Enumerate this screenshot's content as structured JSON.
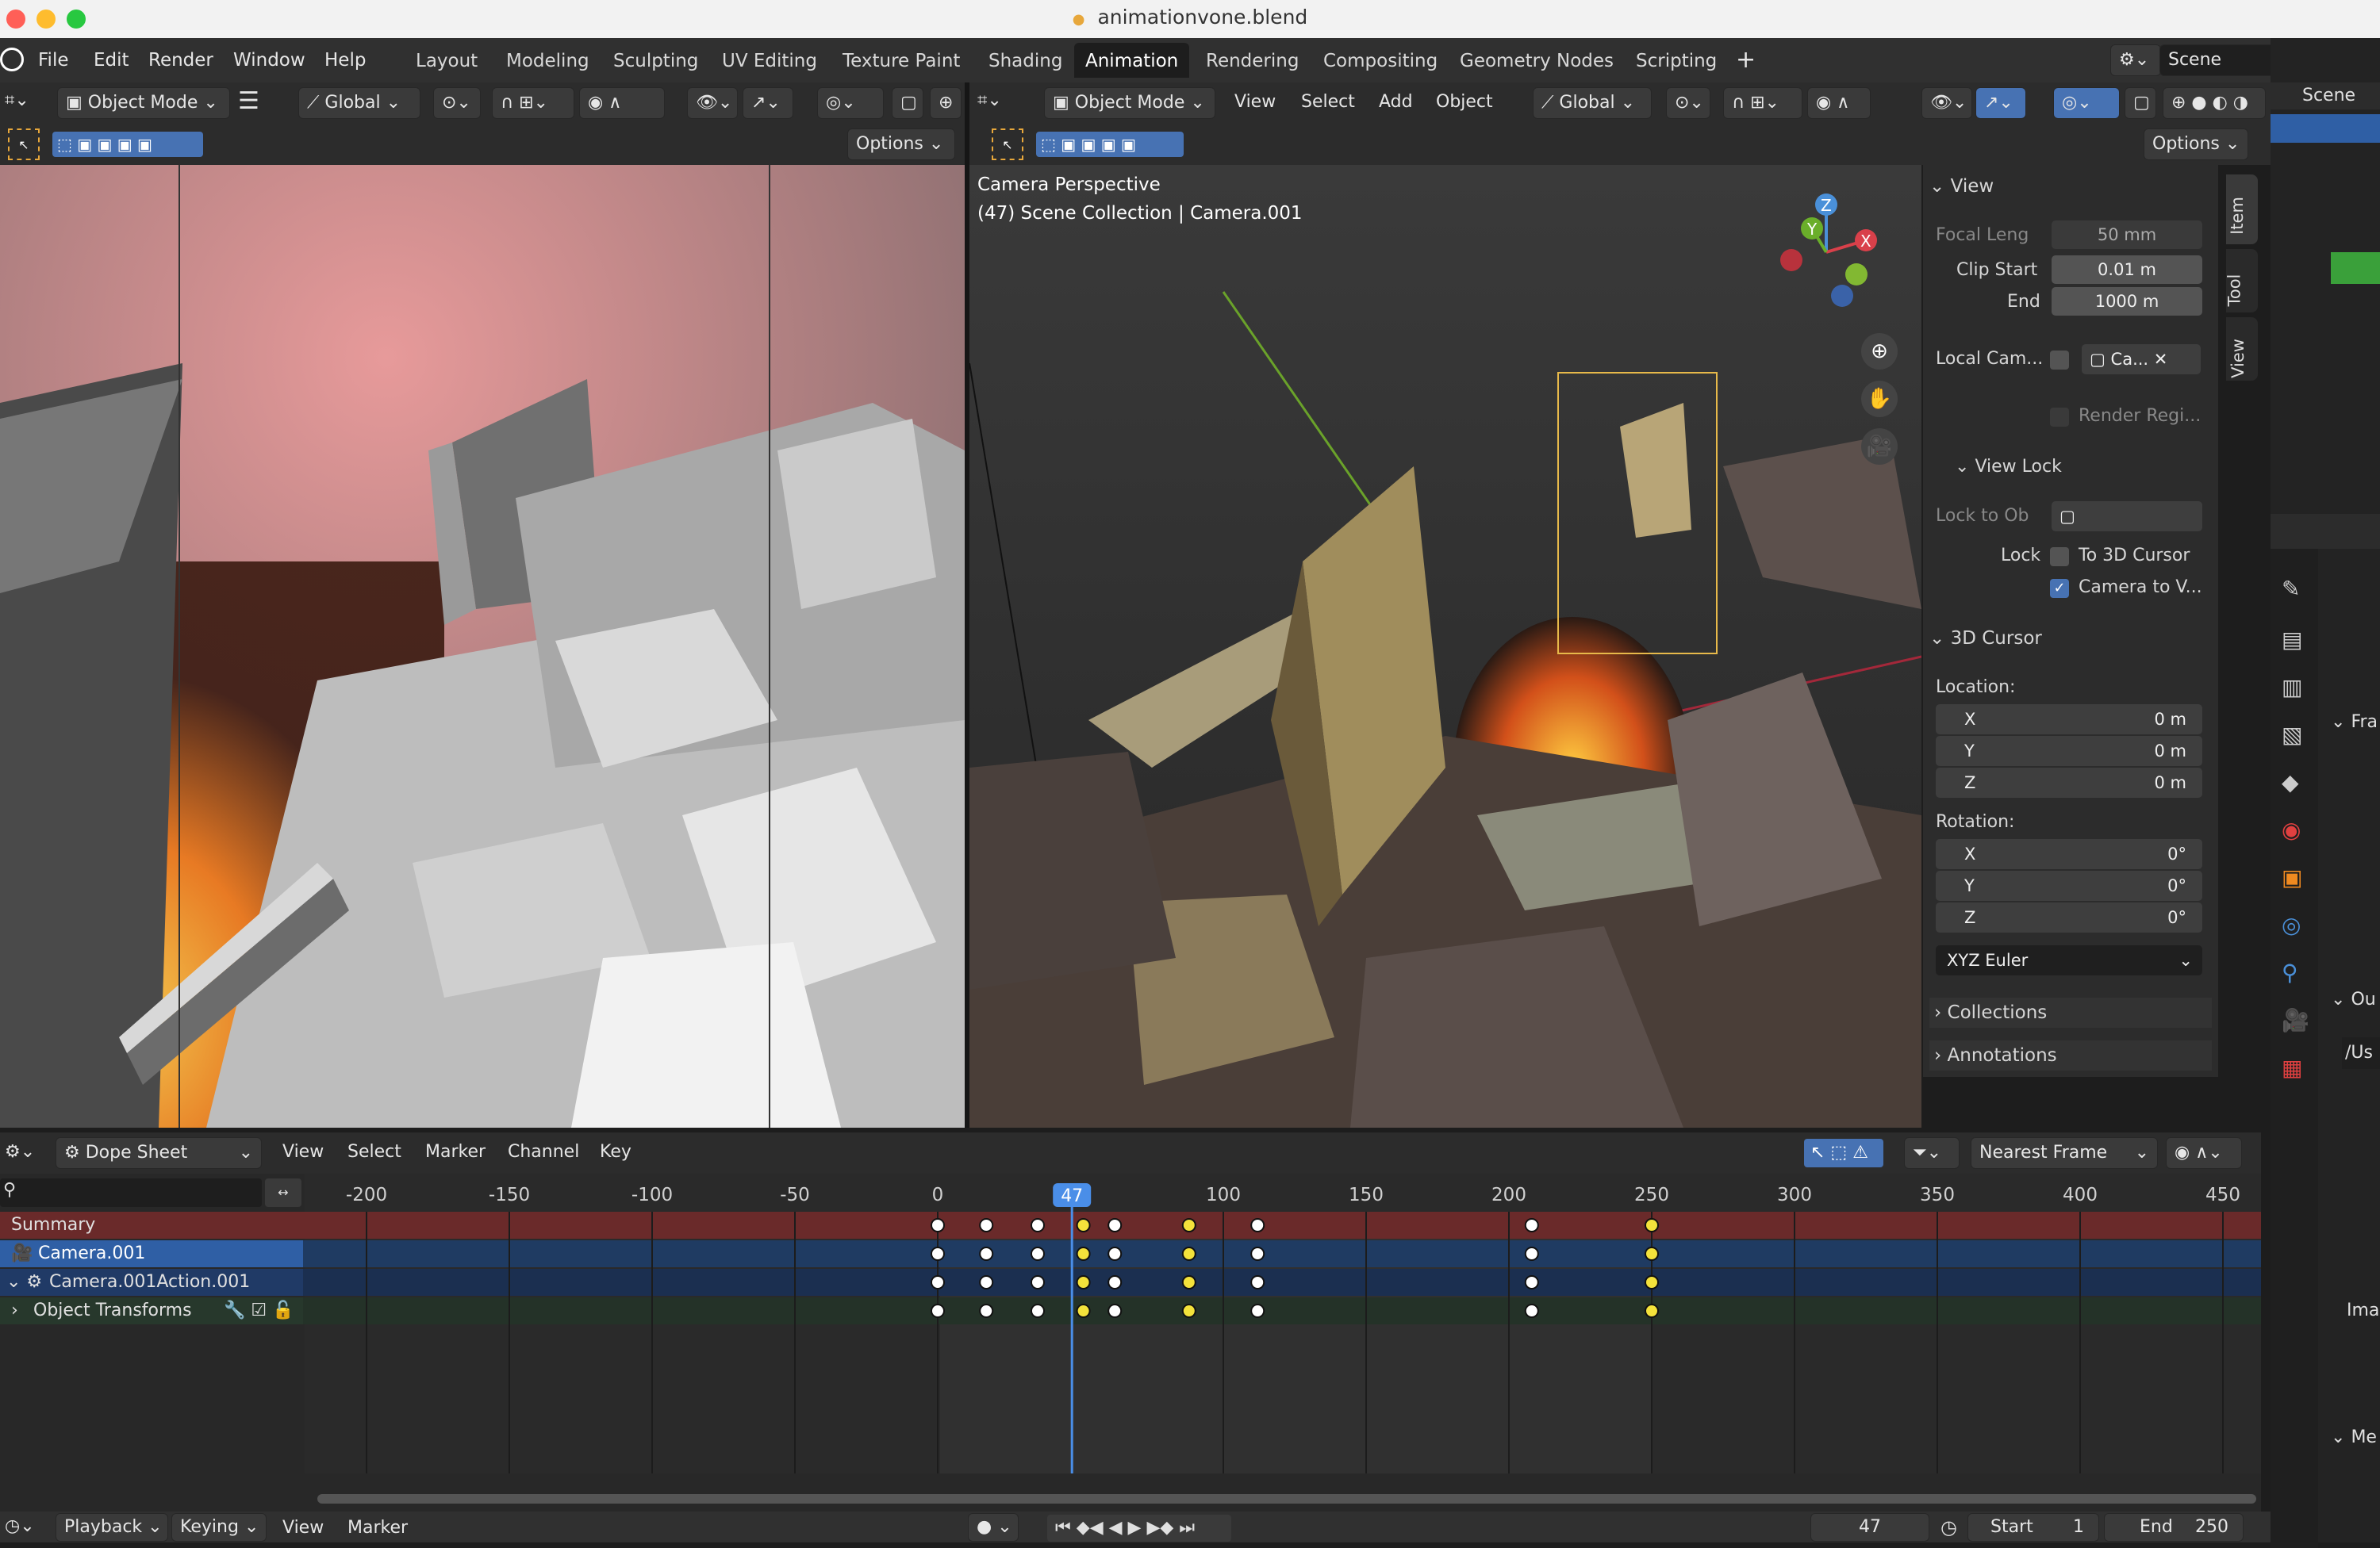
{
  "window": {
    "title": "animationvone.blend"
  },
  "menu": [
    "File",
    "Edit",
    "Render",
    "Window",
    "Help"
  ],
  "workspaces": [
    "Layout",
    "Modeling",
    "Sculpting",
    "UV Editing",
    "Texture Paint",
    "Shading",
    "Animation",
    "Rendering",
    "Compositing",
    "Geometry Nodes",
    "Scripting"
  ],
  "active_workspace": "Animation",
  "scene": "Scene",
  "left_viewport": {
    "mode": "Object Mode",
    "orientation": "Global",
    "options": "Options"
  },
  "right_viewport": {
    "mode": "Object Mode",
    "menus": [
      "View",
      "Select",
      "Add",
      "Object"
    ],
    "orientation": "Global",
    "options": "Options",
    "overlay_line1": "Camera Perspective",
    "overlay_line2": "(47) Scene Collection | Camera.001"
  },
  "npanel": {
    "tabs": [
      "Item",
      "Tool",
      "View"
    ],
    "view_header": "View",
    "focal_label": "Focal Leng",
    "focal_value": "50 mm",
    "clip_start_label": "Clip Start",
    "clip_start_value": "0.01 m",
    "end_label": "End",
    "end_value": "1000 m",
    "local_cam_label": "Local Cam...",
    "local_cam_value": "Ca...",
    "render_region": "Render Regi...",
    "view_lock_header": "View Lock",
    "lock_to_obj_label": "Lock to Ob",
    "lock_label": "Lock",
    "to_cursor": "To 3D Cursor",
    "camera_to_view": "Camera to V...",
    "cursor_header": "3D Cursor",
    "location_label": "Location:",
    "loc": [
      {
        "axis": "X",
        "value": "0 m"
      },
      {
        "axis": "Y",
        "value": "0 m"
      },
      {
        "axis": "Z",
        "value": "0 m"
      }
    ],
    "rotation_label": "Rotation:",
    "rot": [
      {
        "axis": "X",
        "value": "0°"
      },
      {
        "axis": "Y",
        "value": "0°"
      },
      {
        "axis": "Z",
        "value": "0°"
      }
    ],
    "rot_mode": "XYZ Euler",
    "collections": "Collections",
    "annotations": "Annotations"
  },
  "outliner": {
    "scene": "Scene",
    "partial_labels": [
      "Fra",
      "Ou",
      "/Us",
      "Imag",
      "Me"
    ]
  },
  "dope_sheet": {
    "editor": "Dope Sheet",
    "menus": [
      "View",
      "Select",
      "Marker",
      "Channel",
      "Key"
    ],
    "snap": "Nearest Frame",
    "current_frame": "47",
    "ruler": [
      "-200",
      "-150",
      "-100",
      "-50",
      "0",
      "100",
      "150",
      "200",
      "250",
      "300",
      "350",
      "400",
      "450"
    ],
    "channels": [
      "Summary",
      "Camera.001",
      "Camera.001Action.001",
      "Object Transforms"
    ],
    "keyframes": [
      0,
      17,
      35,
      51,
      62,
      88,
      112,
      208,
      250
    ],
    "selected_keyframes": [
      51,
      88,
      250
    ]
  },
  "timeline": {
    "menus": [
      "Playback",
      "Keying",
      "View",
      "Marker"
    ],
    "frame": "47",
    "start_label": "Start",
    "start": "1",
    "end_label": "End",
    "end": "250"
  },
  "colors": {
    "accent": "#4772b3",
    "keyframe_selected": "#f4e23b",
    "playhead": "#4a8ee8",
    "summary": "#6a2a2a",
    "camera_row": "#2f5fa5"
  }
}
